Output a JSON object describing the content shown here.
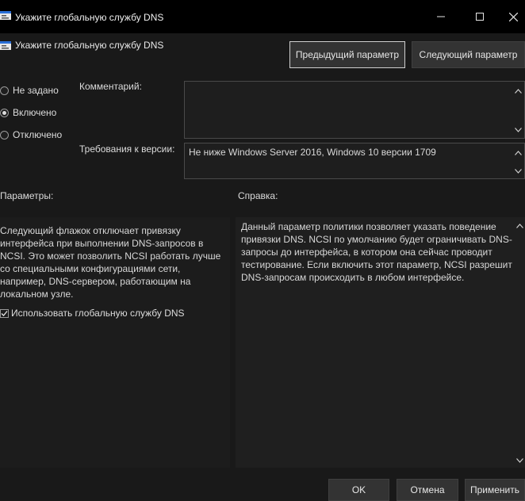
{
  "window": {
    "title": "Укажите глобальную службу DNS",
    "minimize_glyph": "—",
    "maximize_glyph": "☐",
    "close_glyph": "✕"
  },
  "header": {
    "policy_name": "Укажите глобальную службу DNS",
    "prev_button": "Предыдущий параметр",
    "next_button": "Следующий параметр"
  },
  "state": {
    "options": [
      {
        "label": "Не задано",
        "selected": false
      },
      {
        "label": "Включено",
        "selected": true
      },
      {
        "label": "Отключено",
        "selected": false
      }
    ]
  },
  "comment": {
    "label": "Комментарий:",
    "value": ""
  },
  "supported": {
    "label": "Требования к версии:",
    "value": "Не ниже Windows Server 2016, Windows 10 версии 1709"
  },
  "options_panel": {
    "label": "Параметры:",
    "text_lines": [
      "Следующий флажок отключает привязку",
      "интерфейса при выполнении DNS-запросов в",
      "NCSI. Это может позволить NCSI работать лучше",
      "со специальными конфигурациями сети,",
      "например, DNS-сервером, работающим на",
      "локальном узле."
    ],
    "checkbox_label": "Использовать глобальную службу DNS",
    "checkbox_checked": true
  },
  "help_panel": {
    "label": "Справка:",
    "text_lines": [
      "Данный параметр политики позволяет указать поведение",
      "привязки DNS. NCSI по умолчанию будет ограничивать DNS-",
      "запросы до интерфейса, в котором она сейчас проводит",
      "тестирование. Если включить этот параметр, NCSI разрешит",
      "DNS-запросам происходить в любом интерфейсе."
    ]
  },
  "footer": {
    "ok": "OK",
    "cancel": "Отмена",
    "apply": "Применить"
  },
  "icons": {
    "app": "policy-settings-icon",
    "scroll_up": "scroll-up-arrow",
    "scroll_down": "scroll-down-arrow"
  },
  "colors": {
    "background": "#191919",
    "titlebar": "#000000",
    "button": "#333333",
    "text": "#dcdcdc"
  }
}
